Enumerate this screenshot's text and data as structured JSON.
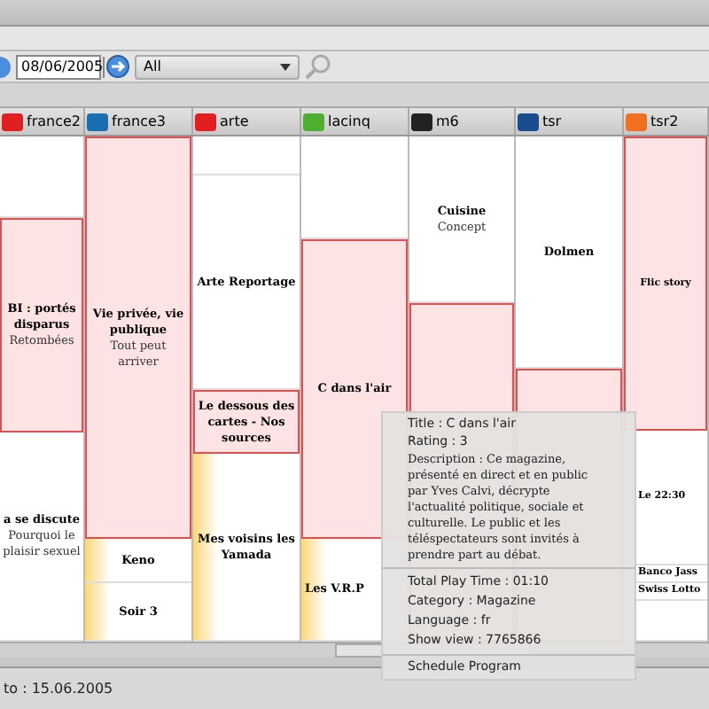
{
  "toolbar": {
    "date": "08/06/2005",
    "filter": "All"
  },
  "channels": [
    {
      "name": "france2",
      "color": "#e02020",
      "programs": [
        {
          "kind": "plain"
        },
        {
          "title": "BI : portés disparus",
          "subtitle": "Retombées",
          "kind": "highlighted"
        },
        {
          "title": "a se discute",
          "subtitle": "Pourquoi le plaisir sexuel",
          "kind": "plain"
        }
      ]
    },
    {
      "name": "france3",
      "color": "#1a6fb0",
      "programs": [
        {
          "title": "Vie privée, vie publique",
          "subtitle": "Tout peut arriver",
          "kind": "highlighted"
        },
        {
          "title": "Keno",
          "kind": "marked"
        },
        {
          "title": "Soir 3",
          "kind": "marked"
        }
      ]
    },
    {
      "name": "arte",
      "color": "#e02020",
      "programs": [
        {
          "kind": "plain"
        },
        {
          "title": "Arte Reportage",
          "kind": "plain"
        },
        {
          "title": "Le dessous des cartes - Nos sources",
          "kind": "highlighted"
        },
        {
          "title": "Mes voisins les Yamada",
          "kind": "marked"
        }
      ]
    },
    {
      "name": "lacinq",
      "color": "#4caf30",
      "programs": [
        {
          "kind": "plain"
        },
        {
          "title": "C dans l'air",
          "kind": "highlighted"
        },
        {
          "title": "Les V.R.P",
          "kind": "marked"
        }
      ]
    },
    {
      "name": "m6",
      "color": "#222222",
      "programs": [
        {
          "title": "Cuisine",
          "subtitle": "Concept",
          "kind": "plain"
        },
        {
          "kind": "highlighted"
        }
      ]
    },
    {
      "name": "tsr",
      "color": "#1a4d8f",
      "programs": [
        {
          "title": "Dolmen",
          "kind": "plain"
        },
        {
          "kind": "highlighted"
        }
      ]
    },
    {
      "name": "tsr2",
      "color": "#f07020",
      "programs": [
        {
          "title": "Flic story",
          "kind": "highlighted"
        },
        {
          "title": "Le 22:30",
          "kind": "plain"
        },
        {
          "title": "Banco Jass",
          "kind": "plain"
        },
        {
          "title": "Swiss Lotto",
          "kind": "plain"
        },
        {
          "kind": "plain"
        }
      ]
    }
  ],
  "tooltip": {
    "details": [
      "Title : C dans l'air",
      "Rating : 3",
      "Description : Ce magazine, présenté en direct et en public par Yves Calvi, décrypte l'actualité politique, sociale et culturelle. Le public et les téléspectateurs sont invités à prendre part au débat."
    ],
    "info": [
      "Total Play Time : 01:10",
      "Category : Magazine",
      "Language : fr",
      "Show view : 7765866"
    ],
    "action": "Schedule Program"
  },
  "status_bar": {
    "text": "to : 15.06.2005"
  }
}
